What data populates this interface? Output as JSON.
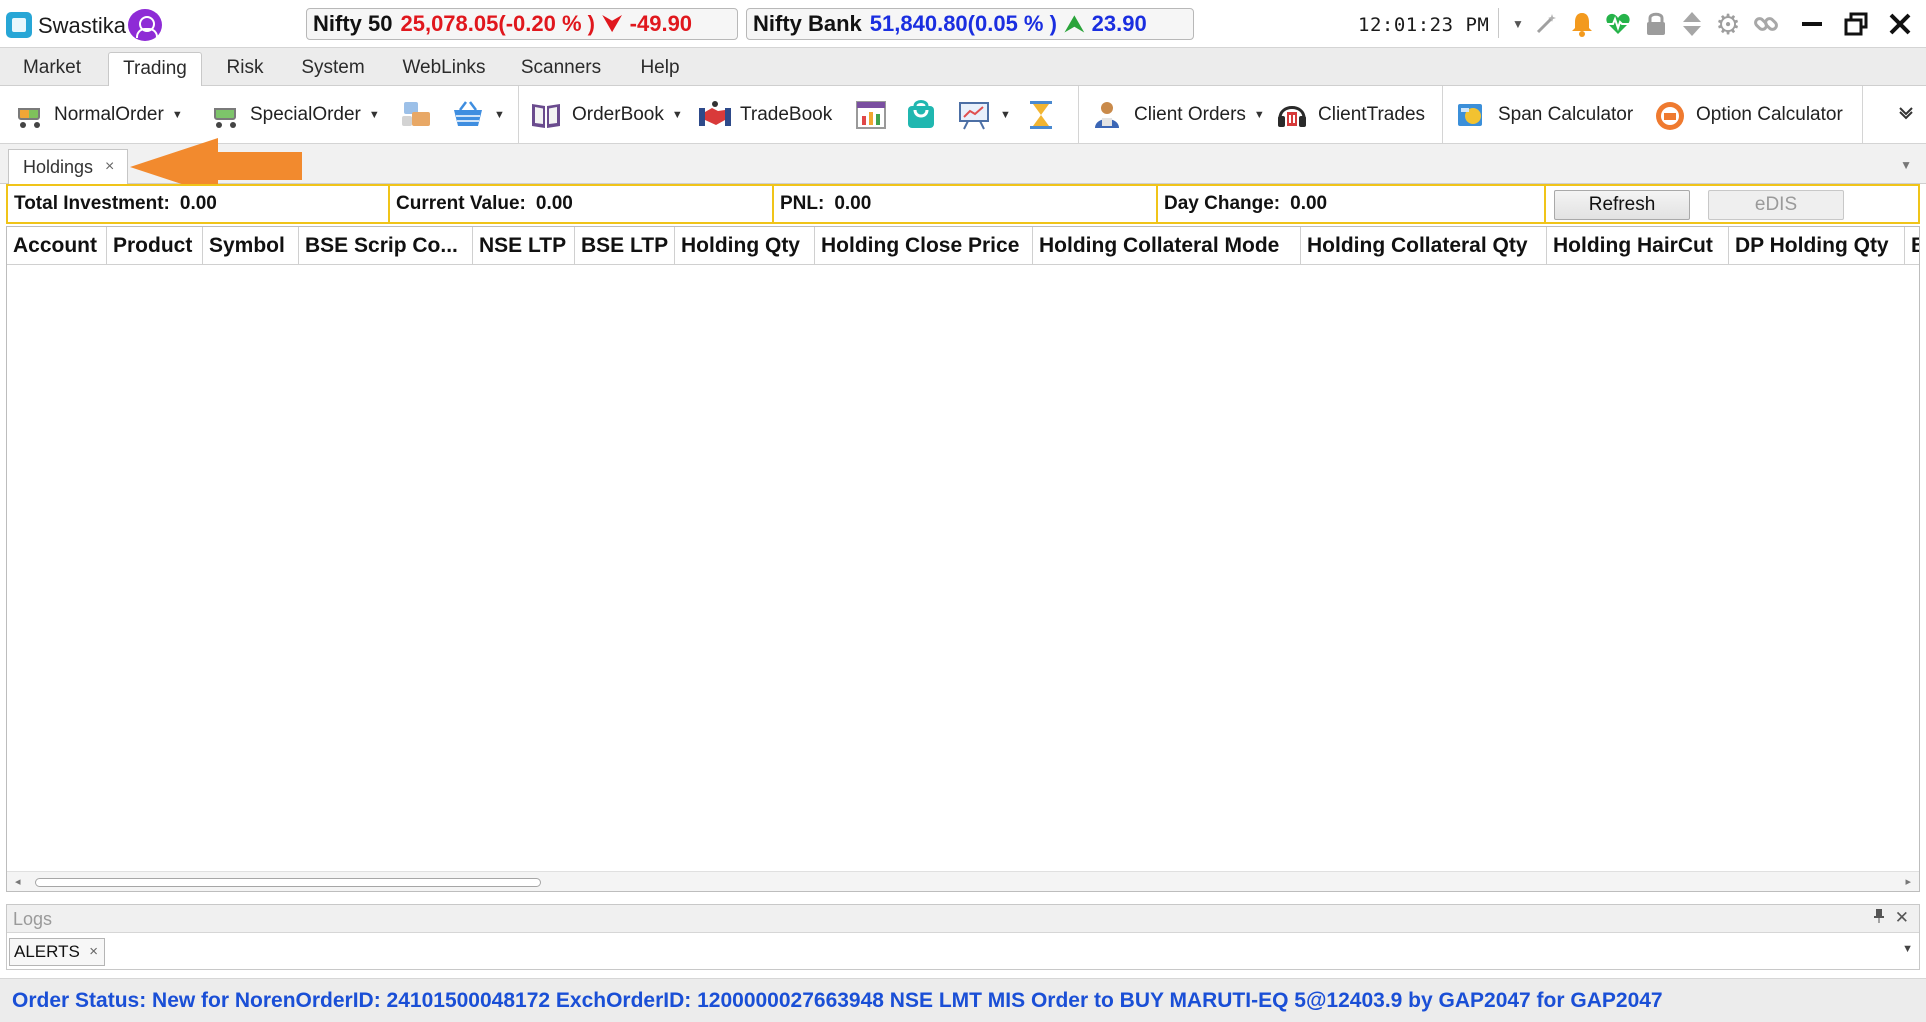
{
  "app": {
    "name": "Swastika"
  },
  "indices": [
    {
      "name": "Nifty 50",
      "value": "25,078.05(",
      "change_pct": "-0.20 % )",
      "change": "-49.90",
      "direction": "down"
    },
    {
      "name": "Nifty Bank",
      "value": "51,840.80(",
      "change_pct": "0.05 % )",
      "change": "23.90",
      "direction": "up"
    }
  ],
  "clock": "12:01:23 PM",
  "titlebar_icons": [
    "dropdown-arrow-icon",
    "magic-wand-icon",
    "bell-icon",
    "heartbeat-icon",
    "lock-icon",
    "sort-arrows-icon",
    "gear-icon",
    "link-icon",
    "minimize-icon",
    "restore-icon",
    "close-icon"
  ],
  "menu": {
    "tabs": [
      "Market",
      "Trading",
      "Risk",
      "System",
      "WebLinks",
      "Scanners",
      "Help"
    ],
    "active": "Trading"
  },
  "toolbar": {
    "normal_order": "NormalOrder",
    "special_order": "SpecialOrder",
    "order_book": "OrderBook",
    "trade_book": "TradeBook",
    "client_orders": "Client Orders",
    "client_trades": "ClientTrades",
    "span_calculator": "Span Calculator",
    "option_calculator": "Option Calculator"
  },
  "document_tab": {
    "label": "Holdings",
    "close_glyph": "×"
  },
  "summary": {
    "total_investment_label": "Total Investment:",
    "total_investment_value": "0.00",
    "current_value_label": "Current Value:",
    "current_value_value": "0.00",
    "pnl_label": "PNL:",
    "pnl_value": "0.00",
    "day_change_label": "Day Change:",
    "day_change_value": "0.00",
    "refresh_label": "Refresh",
    "edis_label": "eDIS"
  },
  "grid": {
    "columns": [
      "Account",
      "Product",
      "Symbol",
      "BSE Scrip Co...",
      "NSE LTP",
      "BSE LTP",
      "Holding Qty",
      "Holding Close Price",
      "Holding Collateral Mode",
      "Holding Collateral Qty",
      "Holding HairCut",
      "DP Holding Qty",
      "B"
    ],
    "rows": []
  },
  "logs": {
    "title": "Logs",
    "tab_label": "ALERTS",
    "tab_close": "×",
    "pin_glyph": "📌",
    "close_glyph": "✕"
  },
  "status_bar": {
    "message": "Order Status: New for NorenOrderID: 24101500048172  ExchOrderID: 1200000027663948  NSE  LMT  MIS  Order to BUY  MARUTI-EQ  5@12403.9  by GAP2047  for GAP2047"
  },
  "colors": {
    "down": "#e0171d",
    "up": "#1a2ee0",
    "up_arrow": "#2aa43a",
    "summary_border": "#f0c419",
    "status_text": "#1a4fd6",
    "annotation_arrow": "#f28a2e"
  }
}
